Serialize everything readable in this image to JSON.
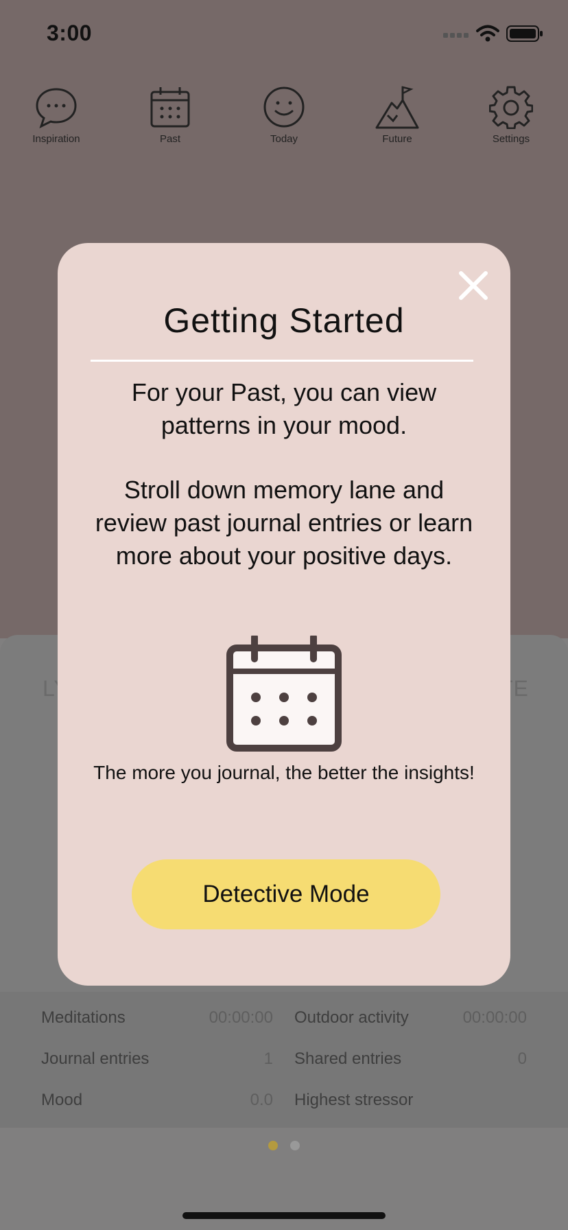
{
  "status_bar": {
    "time": "3:00"
  },
  "nav": {
    "items": [
      {
        "label": "Inspiration",
        "icon": "speech-bubble-icon"
      },
      {
        "label": "Past",
        "icon": "calendar-icon"
      },
      {
        "label": "Today",
        "icon": "smiley-icon"
      },
      {
        "label": "Future",
        "icon": "mountain-flag-icon"
      },
      {
        "label": "Settings",
        "icon": "gear-icon"
      }
    ]
  },
  "background_panel": {
    "left_word_fragment": "LY",
    "right_word_fragment": "TE"
  },
  "stats": {
    "meditations_label": "Meditations",
    "meditations_value": "00:00:00",
    "outdoor_label": "Outdoor activity",
    "outdoor_value": "00:00:00",
    "journal_label": "Journal entries",
    "journal_value": "1",
    "shared_label": "Shared entries",
    "shared_value": "0",
    "mood_label": "Mood",
    "mood_value": "0.0",
    "stressor_label": "Highest stressor",
    "stressor_value": ""
  },
  "pager": {
    "active_color": "#b49a3f",
    "inactive_color": "#999999",
    "count": 2,
    "active_index": 0
  },
  "modal": {
    "title": "Getting Started",
    "paragraph1_line1": "For your Past, you can view",
    "paragraph1_line2": "patterns in your mood.",
    "paragraph2_line1": "Stroll down memory lane and",
    "paragraph2_line2": "review past journal entries or learn",
    "paragraph2_line3": "more about your positive days.",
    "insight_text": "The more you journal, the better the insights!",
    "button_label": "Detective Mode",
    "button_color": "#f6dc72",
    "background_color": "#ead6d1"
  }
}
